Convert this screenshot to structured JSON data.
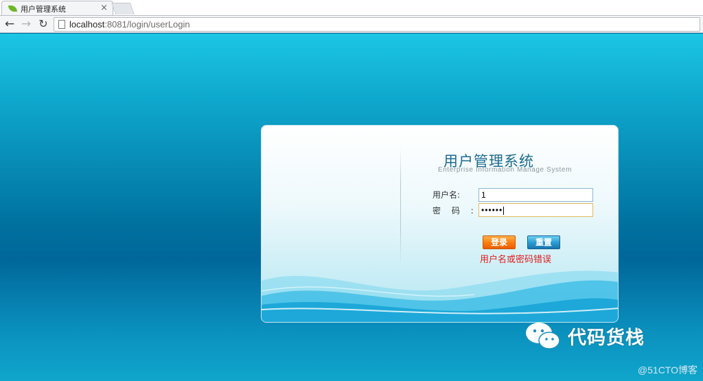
{
  "browser": {
    "tab_title": "用户管理系统",
    "tab_close": "×",
    "back_glyph": "←",
    "forward_glyph": "→",
    "reload_glyph": "↻",
    "url_host": "localhost",
    "url_rest": ":8081/login/userLogin"
  },
  "login": {
    "title": "用户管理系统",
    "subtitle": "Enterprise Information Manage System",
    "username_label": "用户名:",
    "password_label": "密 码 :",
    "username_value": "1",
    "password_masked": "••••••",
    "login_button": "登录",
    "reset_button": "重置",
    "error_message": "用户名或密码错误"
  },
  "watermark": {
    "brand": "代码货栈",
    "corner": "@51CTO博客"
  },
  "colors": {
    "login_button": "#ff7d12",
    "reset_button": "#2c9fd4",
    "error_text": "#e01b1b",
    "page_background": "#00719f"
  }
}
